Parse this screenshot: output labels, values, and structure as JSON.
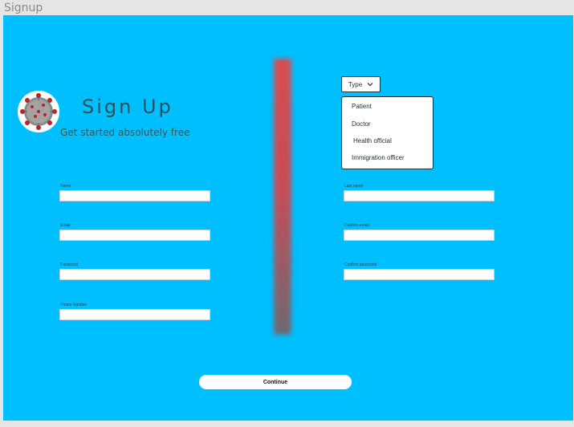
{
  "window": {
    "title": "Signup"
  },
  "header": {
    "heading": "Sign Up",
    "subheading": "Get started absolutely free"
  },
  "form": {
    "fields": [
      {
        "label": "Name",
        "value": ""
      },
      {
        "label": "Last name",
        "value": ""
      },
      {
        "label": "Email",
        "value": ""
      },
      {
        "label": "Confirm email",
        "value": ""
      },
      {
        "label": "Password",
        "value": ""
      },
      {
        "label": "Confirm password",
        "value": ""
      },
      {
        "label": "Phone Number",
        "value": ""
      }
    ],
    "continue_label": "Continue"
  },
  "type_dropdown": {
    "label": "Type",
    "options": [
      "Patient",
      "Doctor",
      "Health official",
      "Immigration officer"
    ]
  },
  "colors": {
    "background": "#00bfff",
    "heading": "#29525e",
    "divider": "#d44e53"
  },
  "icons": {
    "avatar": "coronavirus-icon",
    "dropdown": "chevron-down-icon"
  }
}
